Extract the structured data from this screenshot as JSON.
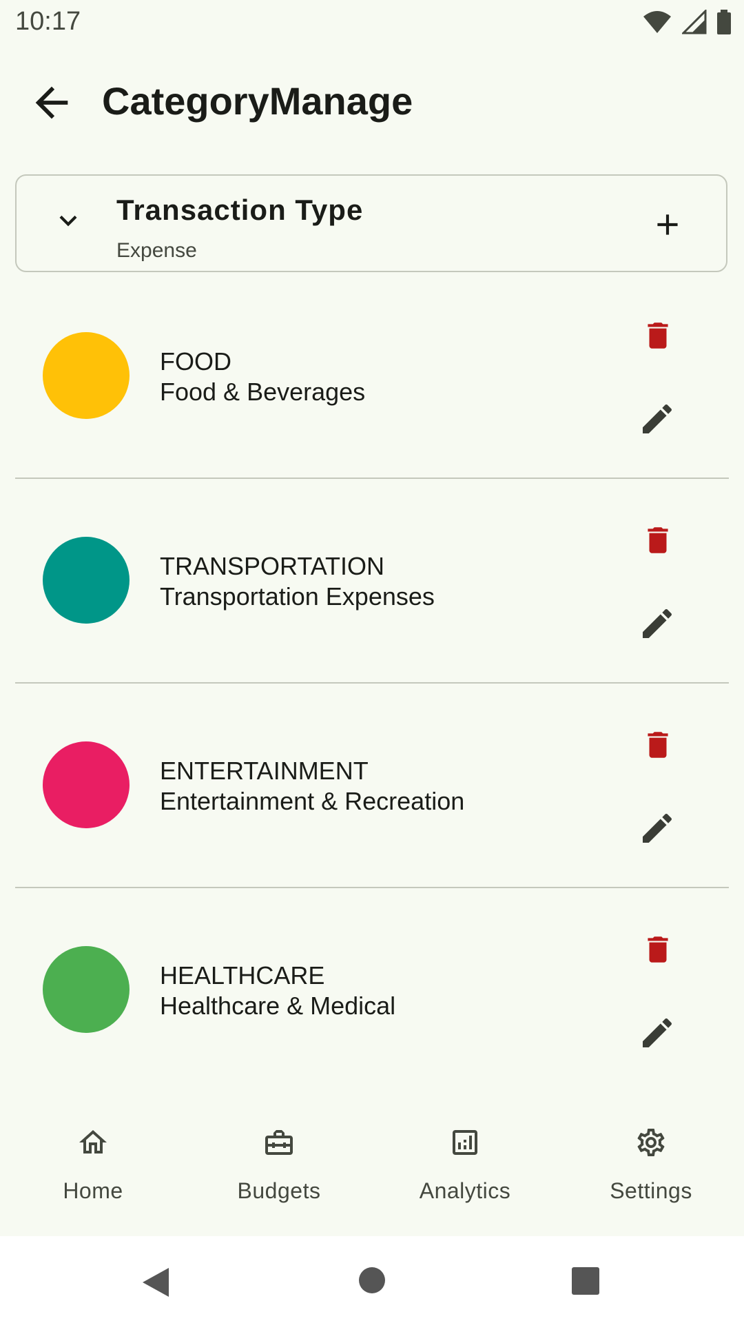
{
  "status": {
    "time": "10:17"
  },
  "header": {
    "title": "CategoryManage"
  },
  "transaction_type": {
    "title": "Transaction Type",
    "value": "Expense"
  },
  "categories": [
    {
      "name": "FOOD",
      "description": "Food & Beverages",
      "color": "#ffc107"
    },
    {
      "name": "TRANSPORTATION",
      "description": "Transportation Expenses",
      "color": "#009688"
    },
    {
      "name": "ENTERTAINMENT",
      "description": "Entertainment & Recreation",
      "color": "#e91e63"
    },
    {
      "name": "HEALTHCARE",
      "description": "Healthcare & Medical",
      "color": "#4caf50"
    }
  ],
  "nav": [
    {
      "label": "Home",
      "icon": "home-icon"
    },
    {
      "label": "Budgets",
      "icon": "briefcase-icon"
    },
    {
      "label": "Analytics",
      "icon": "analytics-icon"
    },
    {
      "label": "Settings",
      "icon": "gear-icon"
    }
  ],
  "colors": {
    "delete": "#ba1a1a",
    "edit": "#3a3d36",
    "background": "#f7faf2"
  }
}
